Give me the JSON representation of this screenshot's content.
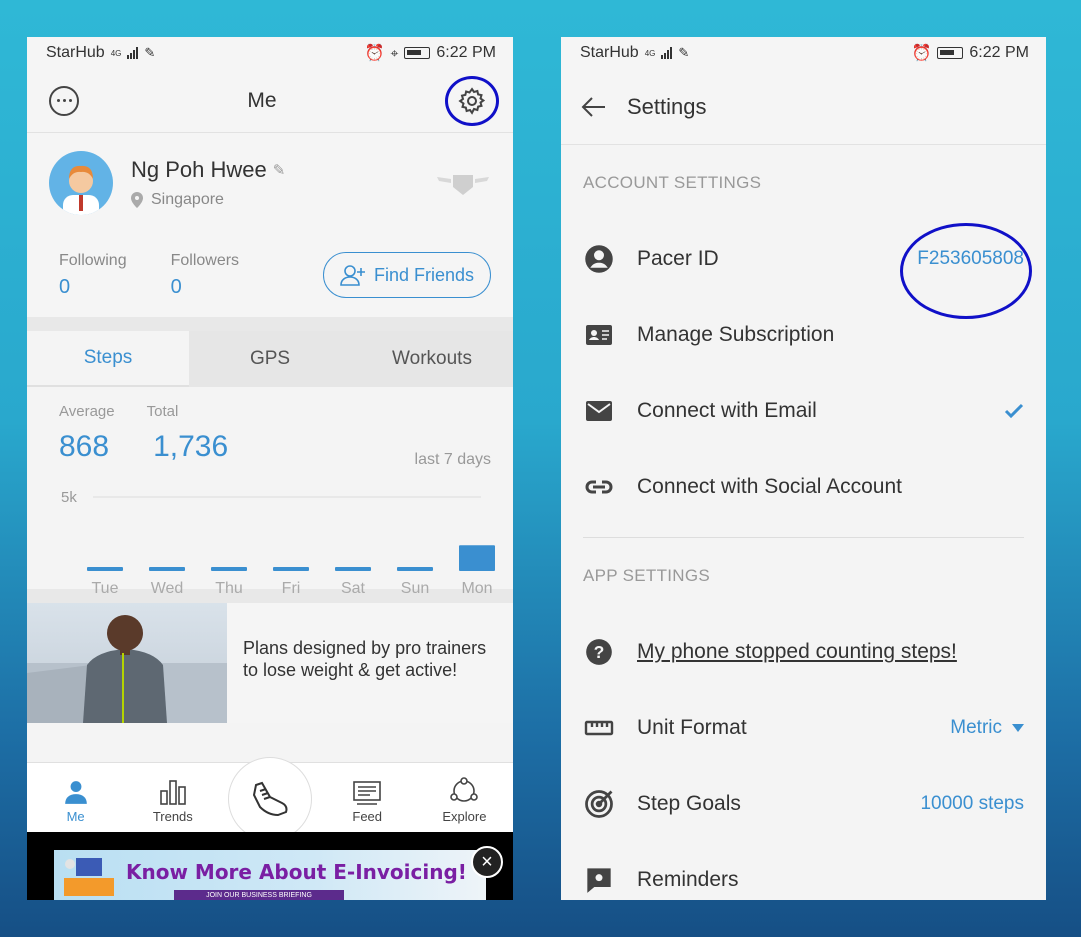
{
  "left": {
    "status": {
      "carrier": "StarHub",
      "network": "4G",
      "time": "6:22 PM"
    },
    "header": {
      "title": "Me"
    },
    "profile": {
      "name": "Ng Poh Hwee",
      "location": "Singapore"
    },
    "follow": {
      "following_label": "Following",
      "following_count": "0",
      "followers_label": "Followers",
      "followers_count": "0",
      "find_friends": "Find Friends"
    },
    "tabs": [
      "Steps",
      "GPS",
      "Workouts"
    ],
    "stats": {
      "average_label": "Average",
      "average_value": "868",
      "total_label": "Total",
      "total_value": "1,736",
      "period": "last 7 days"
    },
    "chart_data": {
      "type": "bar",
      "categories": [
        "Tue",
        "Wed",
        "Thu",
        "Fri",
        "Sat",
        "Sun",
        "Mon"
      ],
      "values": [
        0,
        0,
        0,
        0,
        0,
        0,
        1736
      ],
      "ylim": [
        0,
        5000
      ],
      "ytick_label": "5k",
      "grid": true,
      "bar_color": "#3a8fd0"
    },
    "promo": {
      "text": "Plans designed by pro trainers to lose weight & get active!"
    },
    "nav": [
      {
        "label": "Me",
        "icon": "person-icon"
      },
      {
        "label": "Trends",
        "icon": "bar-chart-icon"
      },
      {
        "label": "",
        "icon": "shoe-icon"
      },
      {
        "label": "Feed",
        "icon": "feed-icon"
      },
      {
        "label": "Explore",
        "icon": "explore-icon"
      }
    ],
    "ad": {
      "title": "Know More About E-Invoicing!",
      "subtitle": "JOIN OUR BUSINESS BRIEFING"
    }
  },
  "right": {
    "status": {
      "carrier": "StarHub",
      "network": "4G",
      "time": "6:22 PM"
    },
    "header": {
      "title": "Settings"
    },
    "account_section": "ACCOUNT SETTINGS",
    "account_rows": [
      {
        "label": "Pacer ID",
        "value": "F253605808",
        "icon": "account-circle-icon"
      },
      {
        "label": "Manage Subscription",
        "value": "",
        "icon": "id-card-icon"
      },
      {
        "label": "Connect with Email",
        "value": "",
        "icon": "mail-icon"
      },
      {
        "label": "Connect with Social Account",
        "value": "",
        "icon": "link-icon"
      }
    ],
    "app_section": "APP SETTINGS",
    "app_rows": [
      {
        "label": "My phone stopped counting steps!",
        "value": "",
        "icon": "help-icon"
      },
      {
        "label": "Unit Format",
        "value": "Metric",
        "icon": "ruler-icon"
      },
      {
        "label": "Step Goals",
        "value": "10000 steps",
        "icon": "target-icon"
      },
      {
        "label": "Reminders",
        "value": "",
        "icon": "reminder-icon"
      }
    ]
  },
  "colors": {
    "accent": "#3a8fd0",
    "highlight": "#1010c8"
  }
}
